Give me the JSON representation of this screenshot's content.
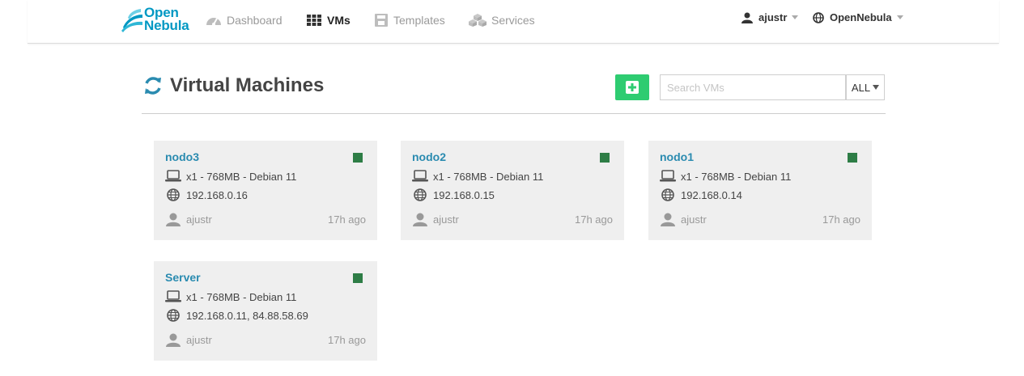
{
  "nav": {
    "brand_line1": "Open",
    "brand_line2": "Nebula",
    "items": [
      {
        "label": "Dashboard",
        "icon": "dashboard-icon",
        "active": false
      },
      {
        "label": "VMs",
        "icon": "grid-icon",
        "active": true
      },
      {
        "label": "Templates",
        "icon": "save-icon",
        "active": false
      },
      {
        "label": "Services",
        "icon": "cubes-icon",
        "active": false
      }
    ],
    "user": {
      "label": "ajustr",
      "icon": "user-icon"
    },
    "zone": {
      "label": "OpenNebula",
      "icon": "globe-icon"
    }
  },
  "page": {
    "title": "Virtual Machines",
    "refresh_icon": "refresh-icon",
    "add_icon": "plus-square-icon",
    "search_placeholder": "Search VMs",
    "search_value": "",
    "filter_label": "ALL"
  },
  "colors": {
    "accent": "#2a8bb0",
    "add_button": "#2ecc71",
    "status_running": "#2e7d46",
    "card_bg": "#efefef"
  },
  "vms": [
    {
      "name": "nodo3",
      "spec": "x1 - 768MB - Debian 11",
      "ips": "192.168.0.16",
      "owner": "ajustr",
      "age": "17h ago"
    },
    {
      "name": "nodo2",
      "spec": "x1 - 768MB - Debian 11",
      "ips": "192.168.0.15",
      "owner": "ajustr",
      "age": "17h ago"
    },
    {
      "name": "nodo1",
      "spec": "x1 - 768MB - Debian 11",
      "ips": "192.168.0.14",
      "owner": "ajustr",
      "age": "17h ago"
    },
    {
      "name": "Server",
      "spec": "x1 - 768MB - Debian 11",
      "ips": "192.168.0.11, 84.88.58.69",
      "owner": "ajustr",
      "age": "17h ago"
    }
  ]
}
